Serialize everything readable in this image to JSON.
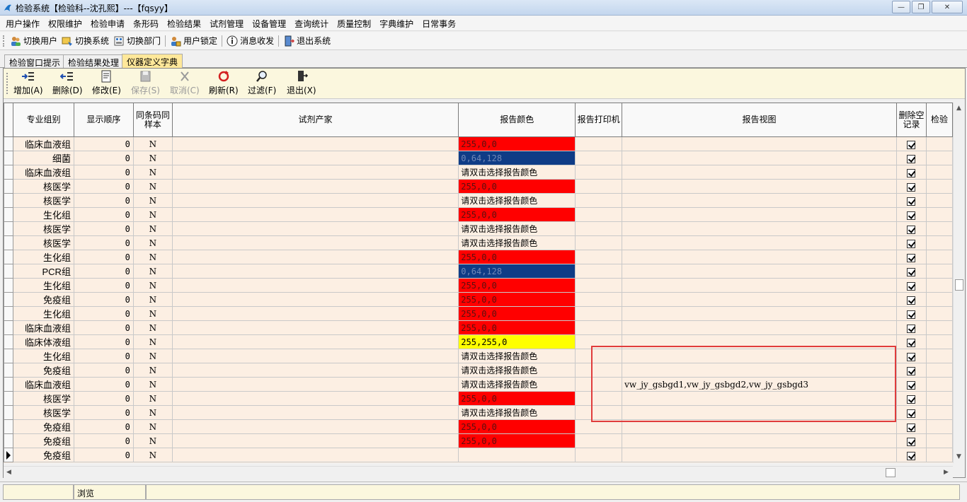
{
  "window": {
    "title": "检验系统【检验科--沈孔熙】---【fqsyy】",
    "controls": {
      "minimize": "—",
      "maximize": "❐",
      "close": "✕"
    }
  },
  "menubar": [
    "用户操作",
    "权限维护",
    "检验申请",
    "条形码",
    "检验结果",
    "试剂管理",
    "设备管理",
    "查询统计",
    "质量控制",
    "字典维护",
    "日常事务"
  ],
  "toolbar": {
    "switch_user": "切换用户",
    "switch_system": "切换系统",
    "switch_dept": "切换部门",
    "lock_user": "用户锁定",
    "messages": "消息收发",
    "exit_system": "退出系统"
  },
  "tabs": [
    "检验窗口提示",
    "检验结果处理",
    "仪器定义字典"
  ],
  "active_tab": "仪器定义字典",
  "actions": {
    "add": "增加(A)",
    "delete": "删除(D)",
    "modify": "修改(E)",
    "save": "保存(S)",
    "cancel": "取消(C)",
    "refresh": "刷新(R)",
    "filter": "过滤(F)",
    "exit": "退出(X)"
  },
  "grid": {
    "columns": {
      "group": "专业组别",
      "order": "显示顺序",
      "same_barcode": "同条码同样本",
      "vendor": "试剂产家",
      "report_color": "报告颜色",
      "report_printer": "报告打印机",
      "report_view": "报告视图",
      "delete_empty": "删除空记录",
      "test": "检验"
    },
    "colors": {
      "red": "#ff0000",
      "blue": "#0f3c86",
      "yellow": "#ffff00"
    },
    "rows": [
      {
        "group": "临床血液组",
        "order": "0",
        "same": "N",
        "vendor": "",
        "color": "255,0,0",
        "tone": "red",
        "printer": "",
        "view": "",
        "del": true
      },
      {
        "group": "细菌",
        "order": "0",
        "same": "N",
        "vendor": "",
        "color": "0,64,128",
        "tone": "blue",
        "printer": "",
        "view": "",
        "del": true
      },
      {
        "group": "临床血液组",
        "order": "0",
        "same": "N",
        "vendor": "",
        "color": "请双击选择报告颜色",
        "tone": "none",
        "printer": "",
        "view": "",
        "del": true
      },
      {
        "group": "核医学",
        "order": "0",
        "same": "N",
        "vendor": "",
        "color": "255,0,0",
        "tone": "red",
        "printer": "",
        "view": "",
        "del": true
      },
      {
        "group": "核医学",
        "order": "0",
        "same": "N",
        "vendor": "",
        "color": "请双击选择报告颜色",
        "tone": "none",
        "printer": "",
        "view": "",
        "del": true
      },
      {
        "group": "生化组",
        "order": "0",
        "same": "N",
        "vendor": "",
        "color": "255,0,0",
        "tone": "red",
        "printer": "",
        "view": "",
        "del": true
      },
      {
        "group": "核医学",
        "order": "0",
        "same": "N",
        "vendor": "",
        "color": "请双击选择报告颜色",
        "tone": "none",
        "printer": "",
        "view": "",
        "del": true
      },
      {
        "group": "核医学",
        "order": "0",
        "same": "N",
        "vendor": "",
        "color": "请双击选择报告颜色",
        "tone": "none",
        "printer": "",
        "view": "",
        "del": true
      },
      {
        "group": "生化组",
        "order": "0",
        "same": "N",
        "vendor": "",
        "color": "255,0,0",
        "tone": "red",
        "printer": "",
        "view": "",
        "del": true
      },
      {
        "group": "PCR组",
        "order": "0",
        "same": "N",
        "vendor": "",
        "color": "0,64,128",
        "tone": "blue",
        "printer": "",
        "view": "",
        "del": true
      },
      {
        "group": "生化组",
        "order": "0",
        "same": "N",
        "vendor": "",
        "color": "255,0,0",
        "tone": "red",
        "printer": "",
        "view": "",
        "del": true
      },
      {
        "group": "免疫组",
        "order": "0",
        "same": "N",
        "vendor": "",
        "color": "255,0,0",
        "tone": "red",
        "printer": "",
        "view": "",
        "del": true
      },
      {
        "group": "生化组",
        "order": "0",
        "same": "N",
        "vendor": "",
        "color": "255,0,0",
        "tone": "red",
        "printer": "",
        "view": "",
        "del": true
      },
      {
        "group": "临床血液组",
        "order": "0",
        "same": "N",
        "vendor": "",
        "color": "255,0,0",
        "tone": "red",
        "printer": "",
        "view": "",
        "del": true
      },
      {
        "group": "临床体液组",
        "order": "0",
        "same": "N",
        "vendor": "",
        "color": "255,255,0",
        "tone": "yellow",
        "printer": "",
        "view": "",
        "del": true
      },
      {
        "group": "生化组",
        "order": "0",
        "same": "N",
        "vendor": "",
        "color": "请双击选择报告颜色",
        "tone": "none",
        "printer": "",
        "view": "",
        "del": true
      },
      {
        "group": "免疫组",
        "order": "0",
        "same": "N",
        "vendor": "",
        "color": "请双击选择报告颜色",
        "tone": "none",
        "printer": "",
        "view": "",
        "del": true
      },
      {
        "group": "临床血液组",
        "order": "0",
        "same": "N",
        "vendor": "",
        "color": "请双击选择报告颜色",
        "tone": "none",
        "printer": "",
        "view": "vw_jy_gsbgd1,vw_jy_gsbgd2,vw_jy_gsbgd3",
        "del": true
      },
      {
        "group": "核医学",
        "order": "0",
        "same": "N",
        "vendor": "",
        "color": "255,0,0",
        "tone": "red",
        "printer": "",
        "view": "",
        "del": true
      },
      {
        "group": "核医学",
        "order": "0",
        "same": "N",
        "vendor": "",
        "color": "请双击选择报告颜色",
        "tone": "none",
        "printer": "",
        "view": "",
        "del": true
      },
      {
        "group": "免疫组",
        "order": "0",
        "same": "N",
        "vendor": "",
        "color": "255,0,0",
        "tone": "red",
        "printer": "",
        "view": "",
        "del": true
      },
      {
        "group": "免疫组",
        "order": "0",
        "same": "N",
        "vendor": "",
        "color": "255,0,0",
        "tone": "red",
        "printer": "",
        "view": "",
        "del": true
      },
      {
        "group": "免疫组",
        "order": "0",
        "same": "N",
        "vendor": "",
        "color": "",
        "tone": "none",
        "printer": "",
        "view": "",
        "del": true
      }
    ],
    "current_row": 22
  },
  "status": {
    "cell1": "",
    "mode": "浏览"
  }
}
